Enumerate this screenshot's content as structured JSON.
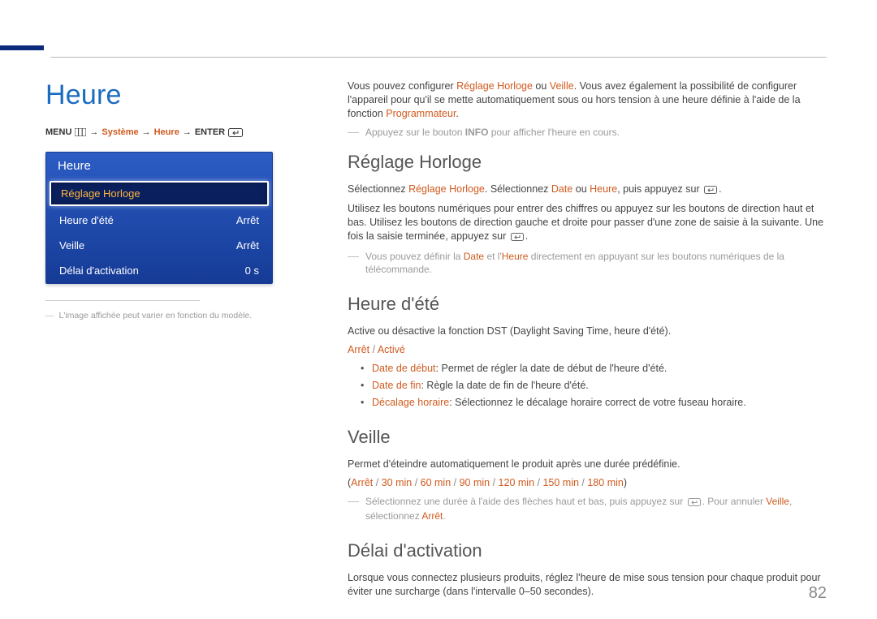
{
  "page_title": "Heure",
  "page_number": "82",
  "breadcrumb": {
    "menu": "MENU",
    "systeme": "Système",
    "heure": "Heure",
    "enter": "ENTER"
  },
  "osd": {
    "title": "Heure",
    "items": [
      {
        "label": "Réglage Horloge",
        "value": "",
        "selected": true
      },
      {
        "label": "Heure d'été",
        "value": "Arrêt",
        "selected": false
      },
      {
        "label": "Veille",
        "value": "Arrêt",
        "selected": false
      },
      {
        "label": "Délai d'activation",
        "value": "0 s",
        "selected": false
      }
    ]
  },
  "left_footnote": "L'image affichée peut varier en fonction du modèle.",
  "intro": {
    "t1a": "Vous pouvez configurer ",
    "l1": "Réglage Horloge",
    "t1b": " ou ",
    "l2": "Veille",
    "t1c": ". Vous avez également la possibilité de configurer l'appareil pour qu'il se mette automatiquement sous ou hors tension à une heure définie à l'aide de la fonction ",
    "l3": "Programmateur",
    "t1d": "."
  },
  "intro_note_a": "Appuyez sur le bouton ",
  "intro_note_bold": "INFO",
  "intro_note_b": " pour afficher l'heure en cours.",
  "h2_1": "Réglage Horloge",
  "rh": {
    "t1a": "Sélectionnez ",
    "l1": "Réglage Horloge",
    "t1b": ". Sélectionnez ",
    "l2": "Date",
    "t1c": " ou ",
    "l3": "Heure",
    "t1d": ", puis appuyez sur ",
    "t1e": ".",
    "p2": "Utilisez les boutons numériques pour entrer des chiffres ou appuyez sur les boutons de direction haut et bas. Utilisez les boutons de direction gauche et droite pour passer d'une zone de saisie à la suivante. Une fois la saisie terminée, appuyez sur ",
    "p2e": ".",
    "note_a": "Vous pouvez définir la ",
    "note_l1": "Date",
    "note_b": " et l'",
    "note_l2": "Heure",
    "note_c": " directement en appuyant sur les boutons numériques de la télécommande."
  },
  "h2_2": "Heure d'été",
  "he": {
    "p1": "Active ou désactive la fonction DST (Daylight Saving Time, heure d'été).",
    "opt1": "Arrêt",
    "sep": " / ",
    "opt2": "Activé",
    "b1_l": "Date de début",
    "b1_t": ": Permet de régler la date de début de l'heure d'été.",
    "b2_l": "Date de fin",
    "b2_t": ": Règle la date de fin de l'heure d'été.",
    "b3_l": "Décalage horaire",
    "b3_t": ": Sélectionnez le décalage horaire correct de votre fuseau horaire."
  },
  "h2_3": "Veille",
  "ve": {
    "p1": "Permet d'éteindre automatiquement le produit après une durée prédéfinie.",
    "opts": [
      "Arrêt",
      "30 min",
      "60 min",
      "90 min",
      "120 min",
      "150 min",
      "180 min"
    ],
    "sep": " / ",
    "paren_open": "(",
    "paren_close": ")",
    "note_a": "Sélectionnez une durée à l'aide des flèches haut et bas, puis appuyez sur ",
    "note_b": ". Pour annuler ",
    "note_l1": "Veille",
    "note_c": ", sélectionnez ",
    "note_l2": "Arrêt",
    "note_d": "."
  },
  "h2_4": "Délai d'activation",
  "da": {
    "p1": "Lorsque vous connectez plusieurs produits, réglez l'heure de mise sous tension pour chaque produit pour éviter une surcharge (dans l'intervalle 0–50 secondes)."
  }
}
